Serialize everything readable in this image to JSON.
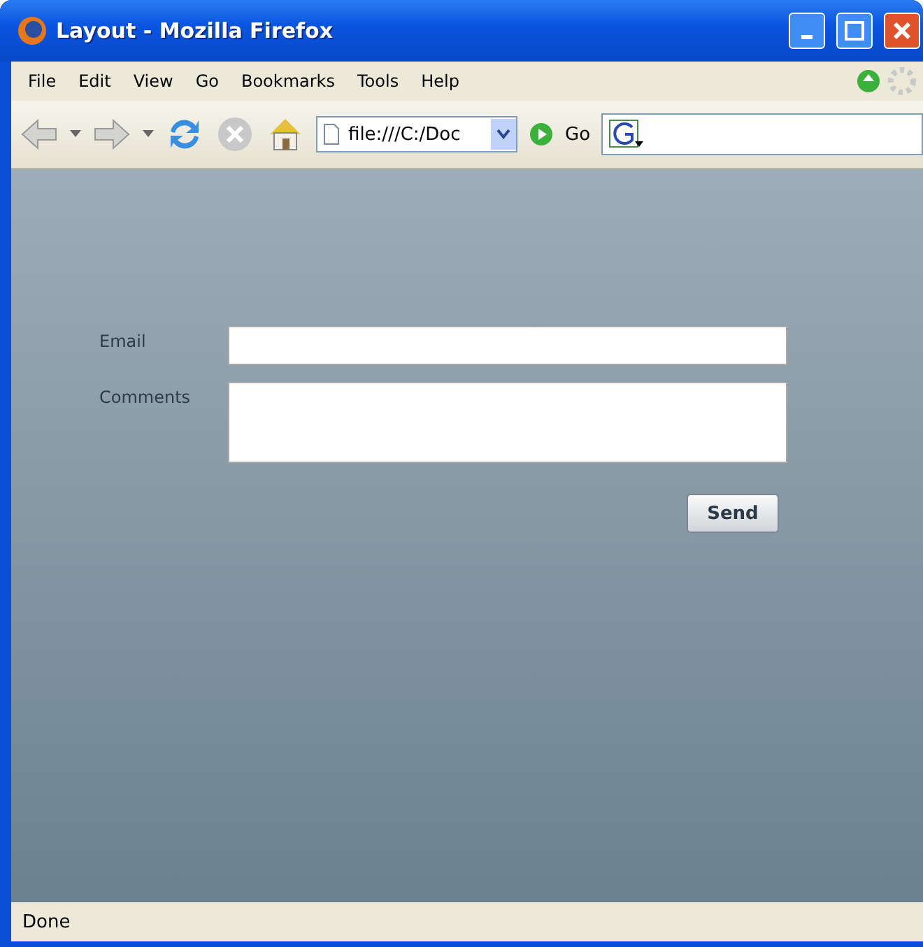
{
  "window": {
    "title": "Layout - Mozilla Firefox"
  },
  "menu": [
    "File",
    "Edit",
    "View",
    "Go",
    "Bookmarks",
    "Tools",
    "Help"
  ],
  "toolbar": {
    "address": "file:///C:/Doc",
    "go": "Go"
  },
  "form": {
    "fields": [
      {
        "label": "Email",
        "kind": "line"
      },
      {
        "label": "Comments",
        "kind": "area"
      }
    ],
    "submit": "Send"
  },
  "status_bar": "Done"
}
